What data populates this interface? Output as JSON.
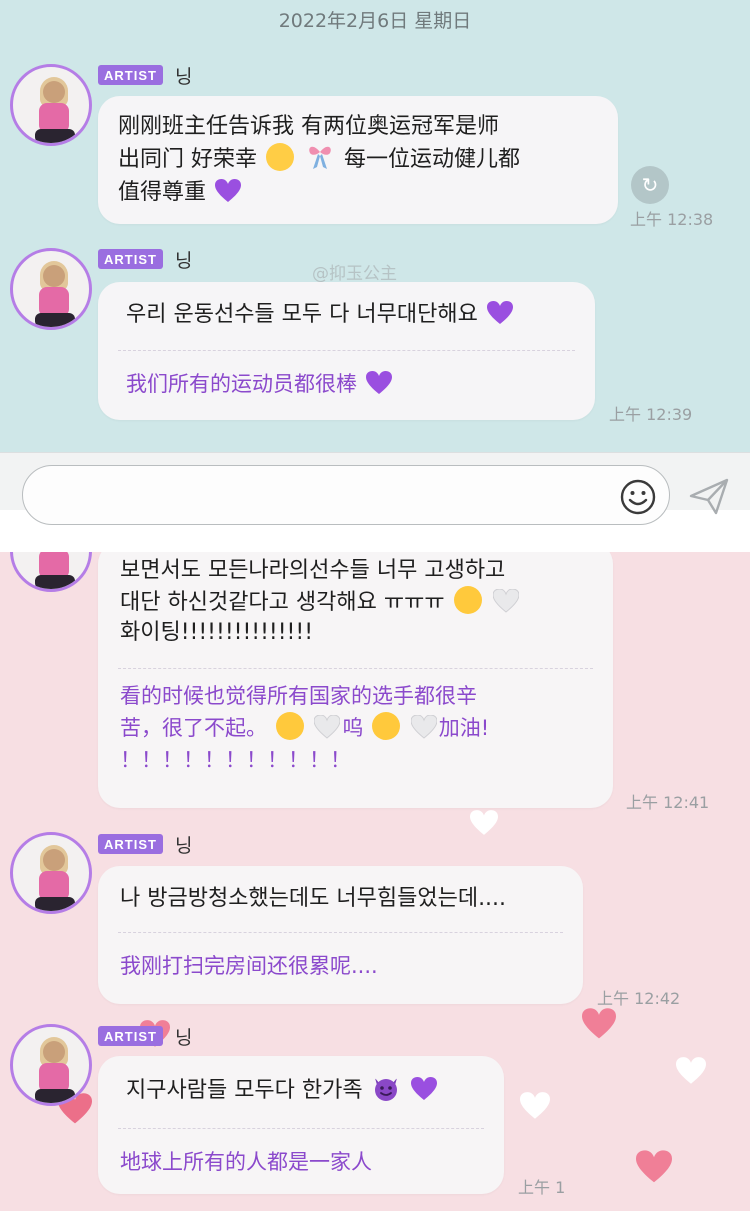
{
  "date": "2022年2月6日 星期日",
  "badge": "ARTIST",
  "sender": "닝",
  "watermark": "@抑玉公主",
  "messages_top": [
    {
      "lines": [
        "刚刚班主任告诉我 有两位奥运冠军是师",
        "出同门 好荣幸",
        "每一位运动健儿都",
        "值得尊重"
      ],
      "time": "上午 12:38"
    },
    {
      "text": "우리 운동선수들 모두 다 너무대단해요",
      "translation": "我们所有的运动员都很棒",
      "time": "上午 12:39"
    }
  ],
  "messages_bottom": [
    {
      "lines": [
        "보면서도 모든나라의선수들 너무 고생하고",
        "대단 하신것같다고 생각해요 ㅠㅠㅠ",
        "화이팅!!!!!!!!!!!!!!!"
      ],
      "translation_lines": [
        "看的时候也觉得所有国家的选手都很辛",
        "苦，很了不起。",
        "呜",
        "加油!",
        "！！！！！！！！！！！"
      ],
      "time": "上午 12:41"
    },
    {
      "text": "나 방금방청소했는데도 너무힘들었는데....",
      "translation": "我刚打扫完房间还很累呢....",
      "time": "上午 12:42"
    },
    {
      "text": "지구사람들 모두다 한가족",
      "translation": "地球上所有的人都是一家人",
      "time": "上午 1"
    }
  ],
  "icons": {
    "refresh": "refresh-icon",
    "emoji": "smile-icon",
    "send": "send-icon"
  },
  "colors": {
    "top_bg": "#cfe7e8",
    "bottom_bg": "#f7dfe3",
    "badge": "#9a6ee0",
    "translation": "#8b49cc"
  }
}
